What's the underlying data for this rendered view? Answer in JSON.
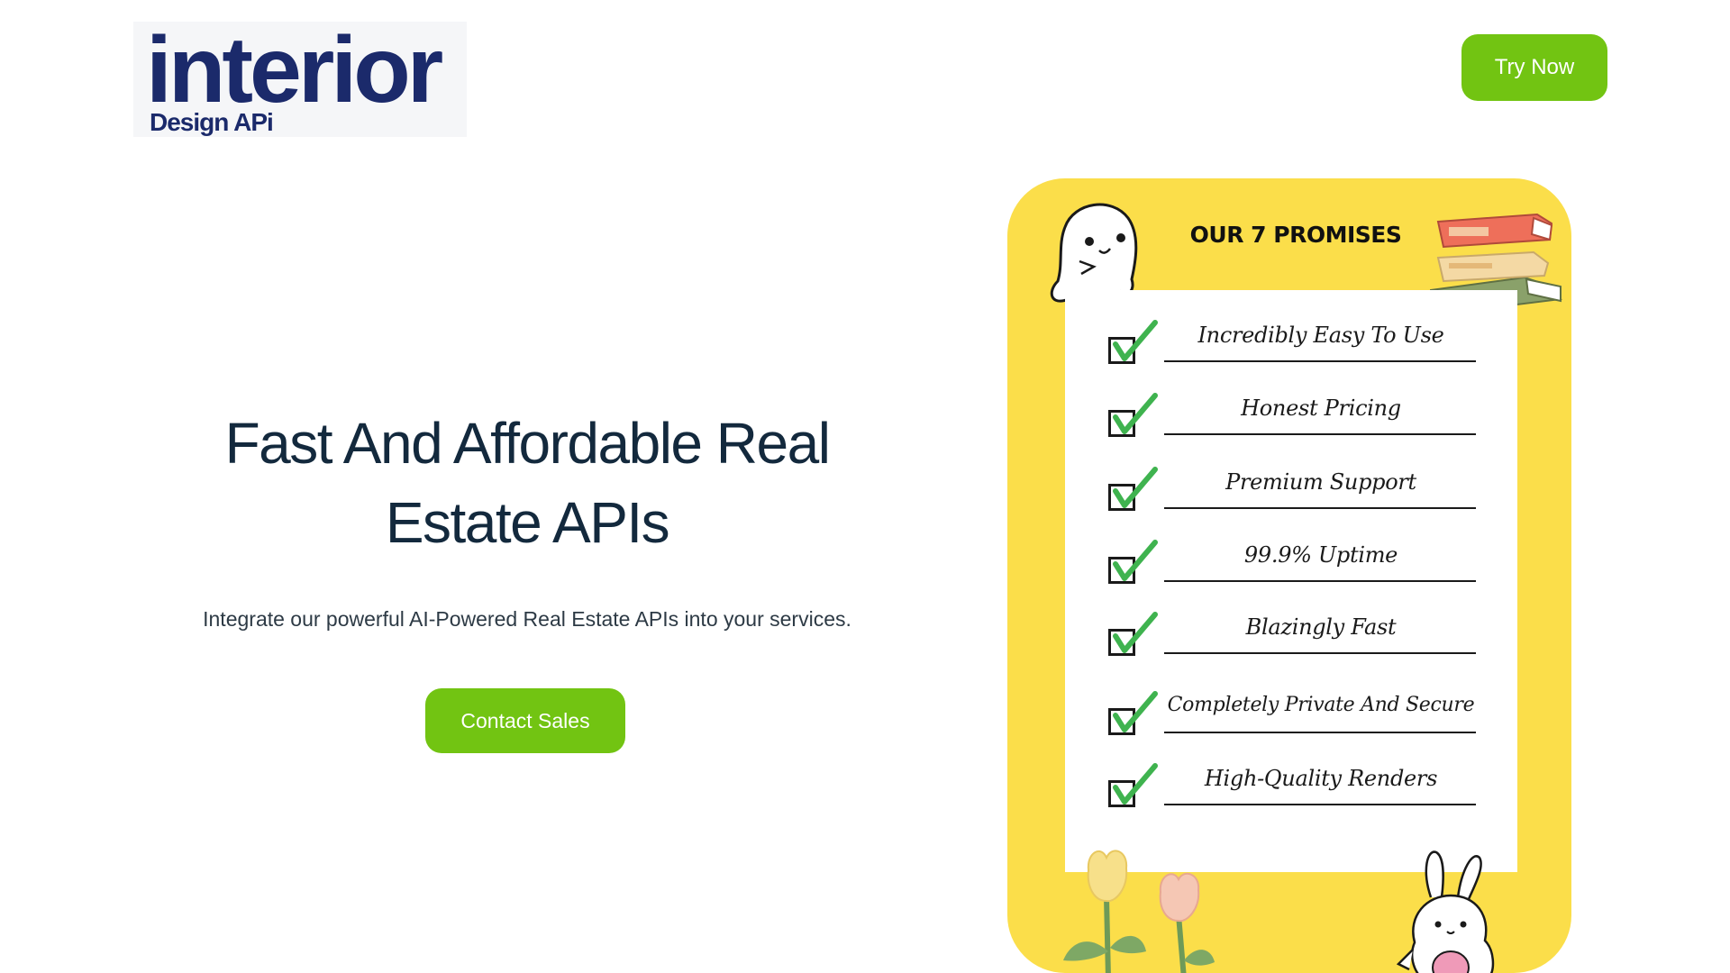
{
  "header": {
    "logo_text": "interior",
    "logo_subtext": "Design APi",
    "try_button": "Try Now"
  },
  "hero": {
    "title_line1": "Fast And Affordable Real",
    "title_line2": "Estate APIs",
    "subtitle": "Integrate our powerful AI-Powered Real Estate APIs into your services.",
    "contact_button": "Contact Sales"
  },
  "promises": {
    "title": "OUR 7 PROMISES",
    "items": [
      "Incredibly Easy To Use",
      "Honest Pricing",
      "Premium Support",
      "99.9% Uptime",
      "Blazingly Fast",
      "Completely Private And Secure",
      "High-Quality Renders"
    ]
  },
  "colors": {
    "accent_green": "#72c412",
    "heading_navy": "#13293d",
    "logo_navy": "#1b2a6b",
    "logo_blue": "#3bbdf2",
    "card_yellow": "#fbde4a",
    "check_green": "#3fb34f"
  },
  "icons": [
    "ghost-icon",
    "books-icon",
    "checkbox-icon",
    "flower-icon",
    "bunny-icon"
  ]
}
